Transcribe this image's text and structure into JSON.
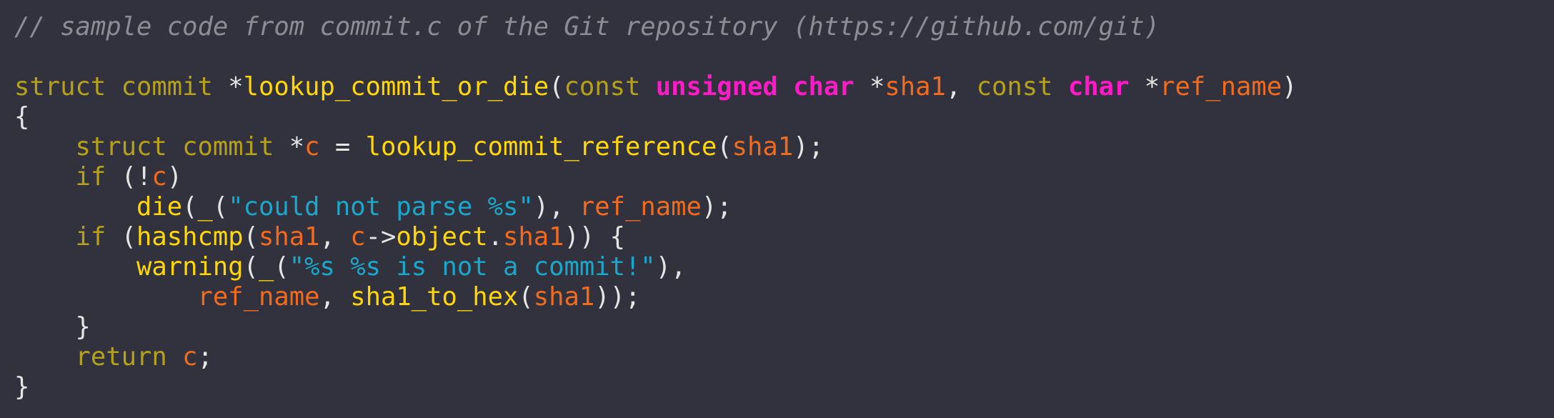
{
  "colors": {
    "background": "#32323f",
    "comment": "#8c8c96",
    "keyword": "#b5a11a",
    "function": "#ffd60a",
    "variable": "#f26b1d",
    "string": "#1aa7c9",
    "type": "#ff1ac8",
    "punctuation": "#e5e5e5"
  },
  "lines": [
    [
      {
        "t": "// sample code from commit.c of the Git repository (https://github.com/git)",
        "k": "comment"
      }
    ],
    [],
    [
      {
        "t": "struct",
        "k": "kw"
      },
      {
        "t": " ",
        "k": "punc"
      },
      {
        "t": "commit",
        "k": "kw"
      },
      {
        "t": " *",
        "k": "punc"
      },
      {
        "t": "lookup_commit_or_die",
        "k": "fn"
      },
      {
        "t": "(",
        "k": "punc"
      },
      {
        "t": "const",
        "k": "kw"
      },
      {
        "t": " ",
        "k": "punc"
      },
      {
        "t": "unsigned",
        "k": "type"
      },
      {
        "t": " ",
        "k": "punc"
      },
      {
        "t": "char",
        "k": "type"
      },
      {
        "t": " *",
        "k": "punc"
      },
      {
        "t": "sha1",
        "k": "var"
      },
      {
        "t": ", ",
        "k": "punc"
      },
      {
        "t": "const",
        "k": "kw"
      },
      {
        "t": " ",
        "k": "punc"
      },
      {
        "t": "char",
        "k": "type"
      },
      {
        "t": " *",
        "k": "punc"
      },
      {
        "t": "ref_name",
        "k": "var"
      },
      {
        "t": ")",
        "k": "punc"
      }
    ],
    [
      {
        "t": "{",
        "k": "punc"
      }
    ],
    [
      {
        "t": "    ",
        "k": "punc"
      },
      {
        "t": "struct",
        "k": "kw"
      },
      {
        "t": " ",
        "k": "punc"
      },
      {
        "t": "commit",
        "k": "kw"
      },
      {
        "t": " *",
        "k": "punc"
      },
      {
        "t": "c",
        "k": "var"
      },
      {
        "t": " = ",
        "k": "punc"
      },
      {
        "t": "lookup_commit_reference",
        "k": "fn"
      },
      {
        "t": "(",
        "k": "punc"
      },
      {
        "t": "sha1",
        "k": "var"
      },
      {
        "t": ");",
        "k": "punc"
      }
    ],
    [
      {
        "t": "    ",
        "k": "punc"
      },
      {
        "t": "if",
        "k": "kw"
      },
      {
        "t": " (!",
        "k": "punc"
      },
      {
        "t": "c",
        "k": "var"
      },
      {
        "t": ")",
        "k": "punc"
      }
    ],
    [
      {
        "t": "        ",
        "k": "punc"
      },
      {
        "t": "die",
        "k": "fn"
      },
      {
        "t": "(",
        "k": "punc"
      },
      {
        "t": "_",
        "k": "fn"
      },
      {
        "t": "(",
        "k": "punc"
      },
      {
        "t": "\"could not parse %s\"",
        "k": "str"
      },
      {
        "t": "), ",
        "k": "punc"
      },
      {
        "t": "ref_name",
        "k": "var"
      },
      {
        "t": ");",
        "k": "punc"
      }
    ],
    [
      {
        "t": "    ",
        "k": "punc"
      },
      {
        "t": "if",
        "k": "kw"
      },
      {
        "t": " (",
        "k": "punc"
      },
      {
        "t": "hashcmp",
        "k": "fn"
      },
      {
        "t": "(",
        "k": "punc"
      },
      {
        "t": "sha1",
        "k": "var"
      },
      {
        "t": ", ",
        "k": "punc"
      },
      {
        "t": "c",
        "k": "var"
      },
      {
        "t": "->",
        "k": "punc"
      },
      {
        "t": "object",
        "k": "fn"
      },
      {
        "t": ".",
        "k": "punc"
      },
      {
        "t": "sha1",
        "k": "var"
      },
      {
        "t": ")) {",
        "k": "punc"
      }
    ],
    [
      {
        "t": "        ",
        "k": "punc"
      },
      {
        "t": "warning",
        "k": "fn"
      },
      {
        "t": "(",
        "k": "punc"
      },
      {
        "t": "_",
        "k": "fn"
      },
      {
        "t": "(",
        "k": "punc"
      },
      {
        "t": "\"%s %s is not a commit!\"",
        "k": "str"
      },
      {
        "t": "),",
        "k": "punc"
      }
    ],
    [
      {
        "t": "            ",
        "k": "punc"
      },
      {
        "t": "ref_name",
        "k": "var"
      },
      {
        "t": ", ",
        "k": "punc"
      },
      {
        "t": "sha1_to_hex",
        "k": "fn"
      },
      {
        "t": "(",
        "k": "punc"
      },
      {
        "t": "sha1",
        "k": "var"
      },
      {
        "t": "));",
        "k": "punc"
      }
    ],
    [
      {
        "t": "    ",
        "k": "punc"
      },
      {
        "t": "}",
        "k": "punc"
      }
    ],
    [
      {
        "t": "    ",
        "k": "punc"
      },
      {
        "t": "return",
        "k": "kw"
      },
      {
        "t": " ",
        "k": "punc"
      },
      {
        "t": "c",
        "k": "var"
      },
      {
        "t": ";",
        "k": "punc"
      }
    ],
    [
      {
        "t": "}",
        "k": "punc"
      }
    ]
  ]
}
